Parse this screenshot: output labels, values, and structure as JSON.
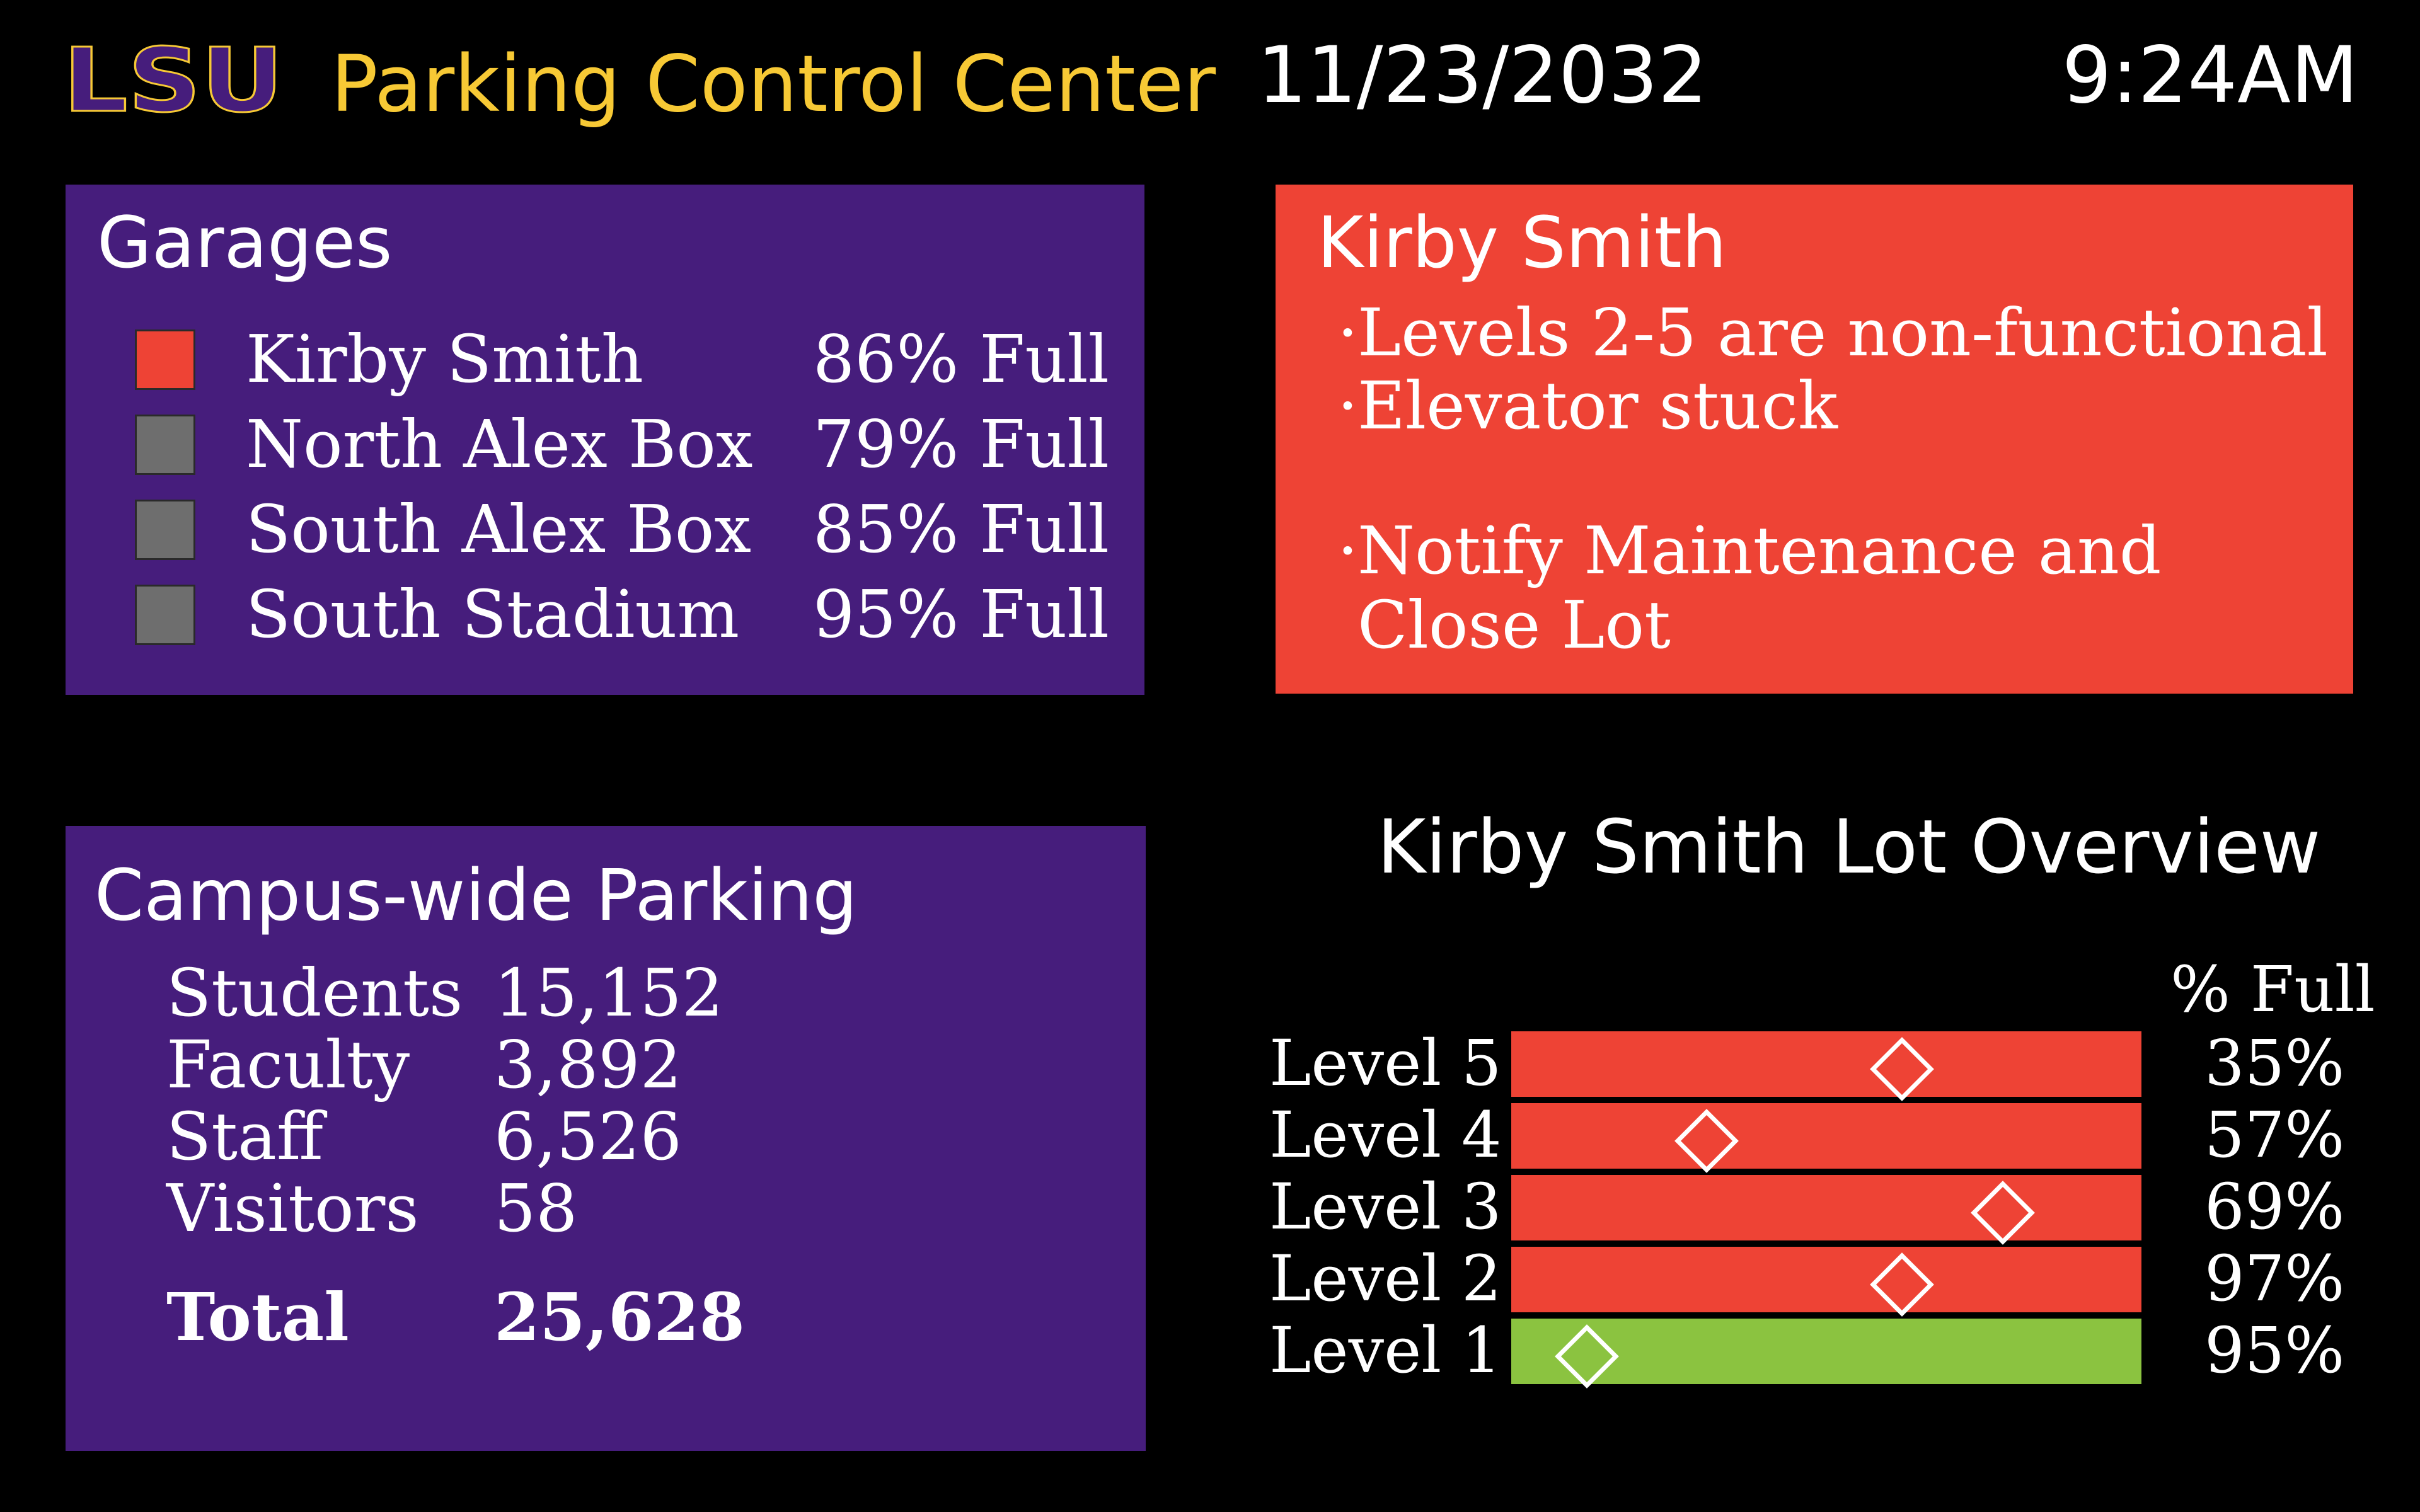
{
  "header": {
    "logo_text": "LSU",
    "title": "Parking Control Center",
    "date": "11/23/2032",
    "time": "9:24AM"
  },
  "colors": {
    "purple": "#461d7c",
    "gold": "#f7c935",
    "alert_red": "#ee4335",
    "ok_green": "#8bc340",
    "neutral_gray": "#6e6e6e"
  },
  "garages": {
    "title": "Garages",
    "items": [
      {
        "name": "Kirby Smith",
        "pct": "86% Full",
        "status_color": "#ee4335"
      },
      {
        "name": "North Alex Box",
        "pct": "79% Full",
        "status_color": "#6e6e6e"
      },
      {
        "name": "South Alex Box",
        "pct": "85% Full",
        "status_color": "#6e6e6e"
      },
      {
        "name": "South Stadium",
        "pct": "95% Full",
        "status_color": "#6e6e6e"
      }
    ]
  },
  "alert": {
    "title": "Kirby Smith",
    "bullet": "·",
    "items": [
      {
        "line1": "Levels 2-5 are non-functional",
        "line2": ""
      },
      {
        "line1": "Elevator stuck",
        "line2": ""
      },
      {
        "line1": "Notify Maintenance and",
        "line2": "Close Lot"
      }
    ]
  },
  "campus": {
    "title": "Campus-wide Parking",
    "rows": [
      {
        "label": "Students",
        "value": "15,152"
      },
      {
        "label": "Faculty",
        "value": "3,892"
      },
      {
        "label": "Staff",
        "value": "6,526"
      },
      {
        "label": "Visitors",
        "value": "58"
      }
    ],
    "total": {
      "label": "Total",
      "value": "25,628"
    }
  },
  "overview": {
    "title": "Kirby Smith Lot Overview",
    "pct_header": "% Full",
    "levels": [
      {
        "label": "Level 5",
        "pct": "35%",
        "marker_fraction": 0.62,
        "status": "non-functional",
        "bar_color": "#ee4335"
      },
      {
        "label": "Level 4",
        "pct": "57%",
        "marker_fraction": 0.31,
        "status": "non-functional",
        "bar_color": "#ee4335"
      },
      {
        "label": "Level 3",
        "pct": "69%",
        "marker_fraction": 0.78,
        "status": "non-functional",
        "bar_color": "#ee4335"
      },
      {
        "label": "Level 2",
        "pct": "97%",
        "marker_fraction": 0.62,
        "status": "non-functional",
        "bar_color": "#ee4335"
      },
      {
        "label": "Level 1",
        "pct": "95%",
        "marker_fraction": 0.12,
        "status": "functional",
        "bar_color": "#8bc340"
      }
    ]
  }
}
